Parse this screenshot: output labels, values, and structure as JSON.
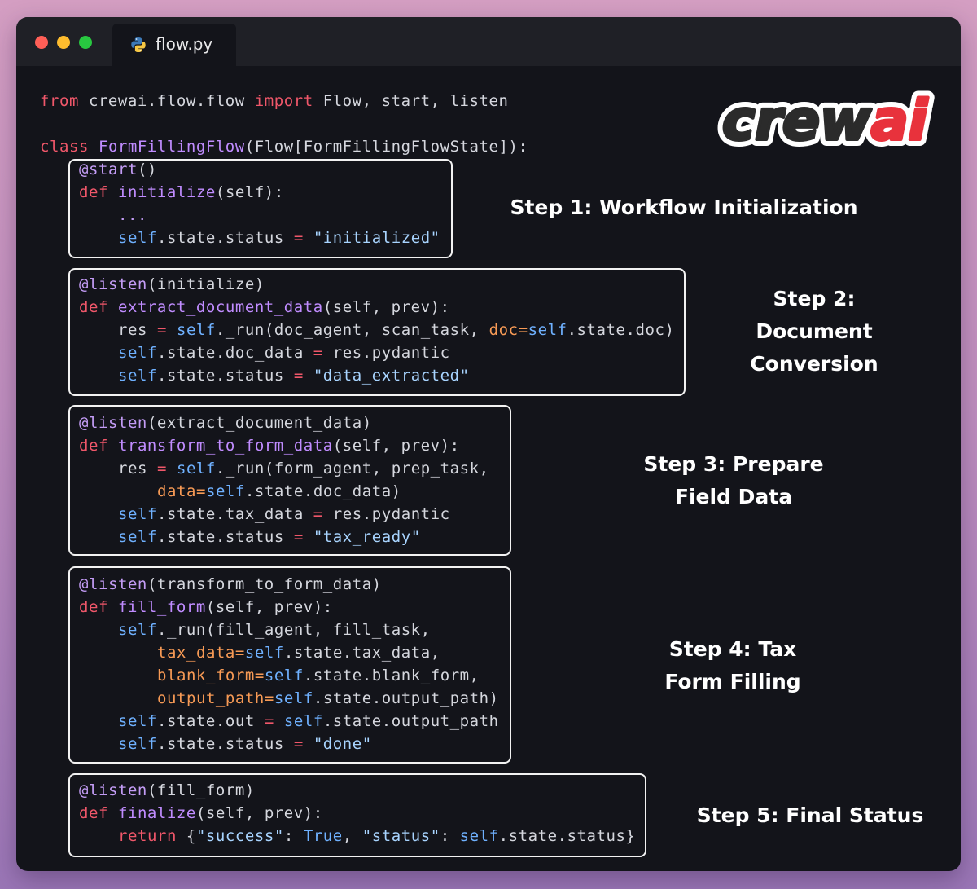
{
  "window": {
    "tab_title": "flow.py",
    "tab_icon": "python-icon"
  },
  "logo": {
    "text_main": "crew",
    "text_accent": "ai",
    "accent_color": "#e8323c"
  },
  "colors": {
    "keyword": "#f0576a",
    "function": "#c08cff",
    "decorator": "#c39cf5",
    "self": "#6fb1ff",
    "string": "#a8d4ff",
    "kwarg": "#f79a55",
    "text": "#d5d7de",
    "editor_bg": "#13141a"
  },
  "code": {
    "import_line": {
      "kw1": "from",
      "module": " crewai.flow.flow ",
      "kw2": "import",
      "names": " Flow, start, listen"
    },
    "class_line": {
      "kw": "class",
      "name": "FormFillingFlow",
      "rest": "(Flow[FormFillingFlowState]):"
    },
    "block1": {
      "decorator": "@start",
      "dec_args": "()",
      "def_kw": "def",
      "func": "initialize",
      "params": "(self):",
      "ellipsis": "...",
      "status_self": "self",
      "status_attr": ".state.status ",
      "status_eq": "=",
      "status_val": " \"initialized\""
    },
    "block2": {
      "decorator": "@listen",
      "dec_args": "(initialize)",
      "def_kw": "def",
      "func": "extract_document_data",
      "params": "(self, prev):",
      "l3_a": "res ",
      "l3_eq": "=",
      "l3_self": " self",
      "l3_b": "._run(doc_agent, scan_task, ",
      "l3_kw": "doc=",
      "l3_self2": "self",
      "l3_c": ".state.doc)",
      "l4_self": "self",
      "l4_a": ".state.doc_data ",
      "l4_eq": "=",
      "l4_b": " res.pydantic",
      "l5_self": "self",
      "l5_a": ".state.status ",
      "l5_eq": "=",
      "l5_val": " \"data_extracted\""
    },
    "block3": {
      "decorator": "@listen",
      "dec_args": "(extract_document_data)",
      "def_kw": "def",
      "func": "transform_to_form_data",
      "params": "(self, prev):",
      "l3_a": "res ",
      "l3_eq": "=",
      "l3_self": " self",
      "l3_b": "._run(form_agent, prep_task,",
      "l4_kw": "data=",
      "l4_self": "self",
      "l4_b": ".state.doc_data)",
      "l5_self": "self",
      "l5_a": ".state.tax_data ",
      "l5_eq": "=",
      "l5_b": " res.pydantic",
      "l6_self": "self",
      "l6_a": ".state.status ",
      "l6_eq": "=",
      "l6_val": " \"tax_ready\""
    },
    "block4": {
      "decorator": "@listen",
      "dec_args": "(transform_to_form_data)",
      "def_kw": "def",
      "func": "fill_form",
      "params": "(self, prev):",
      "l3_self": "self",
      "l3_b": "._run(fill_agent, fill_task,",
      "l4_kw": "tax_data=",
      "l4_self": "self",
      "l4_b": ".state.tax_data,",
      "l5_kw": "blank_form=",
      "l5_self": "self",
      "l5_b": ".state.blank_form,",
      "l6_kw": "output_path=",
      "l6_self": "self",
      "l6_b": ".state.output_path)",
      "l7_self": "self",
      "l7_a": ".state.out ",
      "l7_eq": "=",
      "l7_self2": " self",
      "l7_b": ".state.output_path",
      "l8_self": "self",
      "l8_a": ".state.status ",
      "l8_eq": "=",
      "l8_val": " \"done\""
    },
    "block5": {
      "decorator": "@listen",
      "dec_args": "(fill_form)",
      "def_kw": "def",
      "func": "finalize",
      "params": "(self, prev):",
      "ret_kw": "return",
      "r_a": " {",
      "r_s1": "\"success\"",
      "r_b": ": ",
      "r_true": "True",
      "r_c": ", ",
      "r_s2": "\"status\"",
      "r_d": ": ",
      "r_self": "self",
      "r_e": ".state.status}"
    }
  },
  "steps": {
    "step1": [
      "Step 1: Workflow Initialization"
    ],
    "step2": [
      "Step 2:",
      "Document",
      "Conversion"
    ],
    "step3": [
      "Step 3: Prepare",
      "Field Data"
    ],
    "step4": [
      "Step 4: Tax",
      "Form Filling"
    ],
    "step5": [
      "Step 5: Final Status"
    ]
  }
}
